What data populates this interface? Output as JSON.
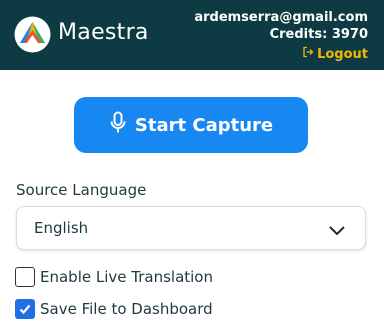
{
  "header": {
    "brand": "Maestra",
    "email": "ardemserra@gmail.com",
    "credits": "Credits: 3970",
    "logout": "Logout"
  },
  "capture": {
    "start_label": "Start Capture"
  },
  "source_language": {
    "label": "Source Language",
    "selected": "English"
  },
  "options": {
    "live_translation": {
      "label": "Enable Live Translation",
      "checked": false
    },
    "save_to_dashboard": {
      "label": "Save File to Dashboard",
      "checked": true
    }
  },
  "colors": {
    "header_bg": "#0e3b43",
    "accent_blue": "#1787f2",
    "logout_yellow": "#f2b705",
    "checkbox_blue": "#1f6fe5"
  },
  "icons": [
    "maestra-logo",
    "logout-icon",
    "microphone-icon",
    "chevron-down-icon",
    "checkmark-icon"
  ]
}
